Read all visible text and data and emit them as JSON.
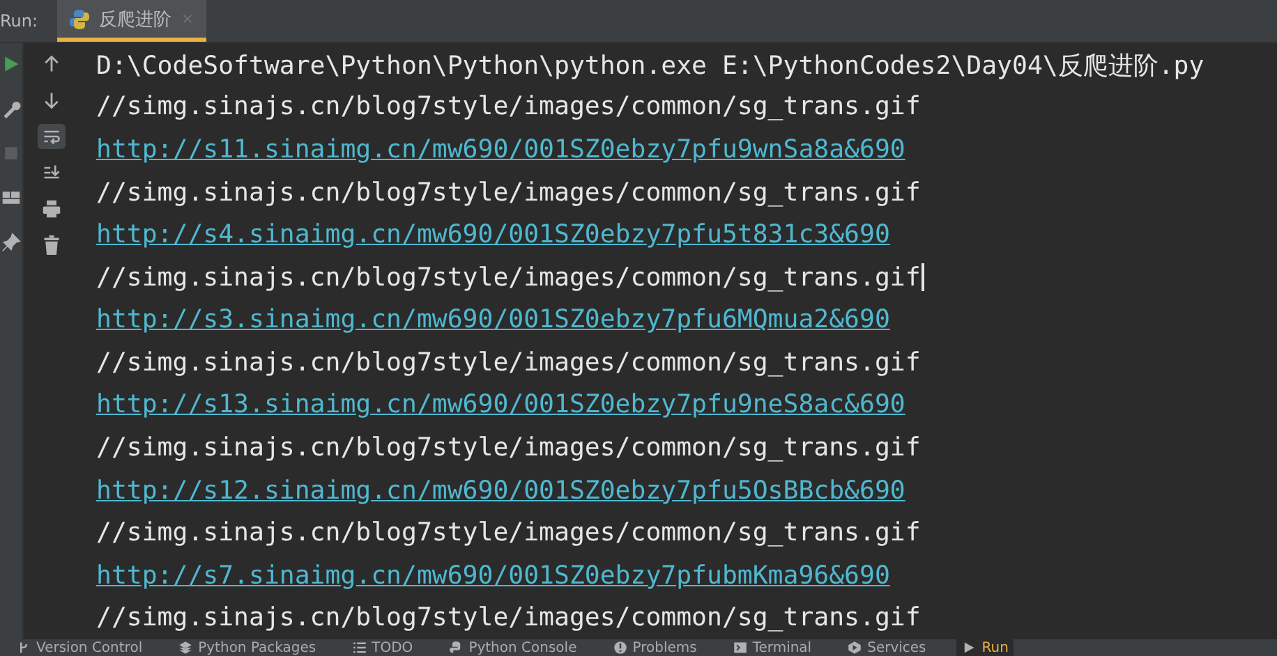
{
  "run_panel": {
    "label": "Run:",
    "tabs": [
      {
        "label": "反爬进阶",
        "selected": true
      }
    ]
  },
  "toolbar_left": [
    {
      "kind": "run"
    },
    {
      "kind": "wrench"
    },
    {
      "kind": "stop"
    },
    {
      "kind": "layout"
    },
    {
      "kind": "pin"
    }
  ],
  "toolbar_right": [
    {
      "kind": "up",
      "selected": false
    },
    {
      "kind": "down",
      "selected": false
    },
    {
      "kind": "wrap",
      "selected": true
    },
    {
      "kind": "scroll-end",
      "selected": false
    },
    {
      "kind": "print",
      "selected": false
    },
    {
      "kind": "trash",
      "selected": false
    }
  ],
  "console_lines": [
    {
      "kind": "command",
      "text": "D:\\CodeSoftware\\Python\\Python\\python.exe E:\\PythonCodes2\\Day04\\反爬进阶.py",
      "cursor": false
    },
    {
      "kind": "text",
      "text": "//simg.sinajs.cn/blog7style/images/common/sg_trans.gif",
      "cursor": false
    },
    {
      "kind": "link",
      "text": "http://s11.sinaimg.cn/mw690/001SZ0ebzy7pfu9wnSa8a&690",
      "cursor": false
    },
    {
      "kind": "text",
      "text": "//simg.sinajs.cn/blog7style/images/common/sg_trans.gif",
      "cursor": false
    },
    {
      "kind": "link",
      "text": "http://s4.sinaimg.cn/mw690/001SZ0ebzy7pfu5t831c3&690",
      "cursor": false
    },
    {
      "kind": "text",
      "text": "//simg.sinajs.cn/blog7style/images/common/sg_trans.gif",
      "cursor": true
    },
    {
      "kind": "link",
      "text": "http://s3.sinaimg.cn/mw690/001SZ0ebzy7pfu6MQmua2&690",
      "cursor": false
    },
    {
      "kind": "text",
      "text": "//simg.sinajs.cn/blog7style/images/common/sg_trans.gif",
      "cursor": false
    },
    {
      "kind": "link",
      "text": "http://s13.sinaimg.cn/mw690/001SZ0ebzy7pfu9neS8ac&690",
      "cursor": false
    },
    {
      "kind": "text",
      "text": "//simg.sinajs.cn/blog7style/images/common/sg_trans.gif",
      "cursor": false
    },
    {
      "kind": "link",
      "text": "http://s12.sinaimg.cn/mw690/001SZ0ebzy7pfu5OsBBcb&690",
      "cursor": false
    },
    {
      "kind": "text",
      "text": "//simg.sinajs.cn/blog7style/images/common/sg_trans.gif",
      "cursor": false
    },
    {
      "kind": "link",
      "text": "http://s7.sinaimg.cn/mw690/001SZ0ebzy7pfubmKma96&690",
      "cursor": false
    },
    {
      "kind": "text",
      "text": "//simg.sinajs.cn/blog7style/images/common/sg_trans.gif",
      "cursor": false
    }
  ],
  "status_bar": [
    {
      "kind": "vcs",
      "label": "Version Control",
      "selected": false
    },
    {
      "kind": "packages",
      "label": "Python Packages",
      "selected": false
    },
    {
      "kind": "todo",
      "label": "TODO",
      "selected": false
    },
    {
      "kind": "python",
      "label": "Python Console",
      "selected": false
    },
    {
      "kind": "problems",
      "label": "Problems",
      "selected": false
    },
    {
      "kind": "terminal",
      "label": "Terminal",
      "selected": false
    },
    {
      "kind": "services",
      "label": "Services",
      "selected": false
    },
    {
      "kind": "run",
      "label": "Run",
      "selected": true
    }
  ]
}
